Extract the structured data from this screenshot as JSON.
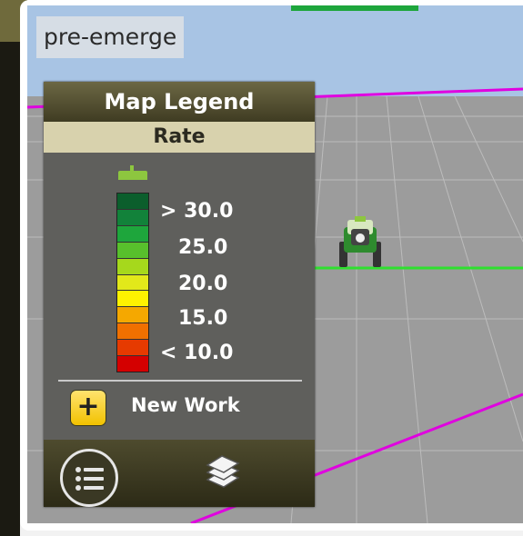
{
  "map": {
    "layer_name": "pre-emerge",
    "colors": {
      "field": "#9c9c9c",
      "sky": "#a8c4e4",
      "boundary_line": "#e000e0",
      "guidance_line": "#2ee02e"
    }
  },
  "legend": {
    "title": "Map Legend",
    "subtitle": "Rate",
    "scale_labels": [
      "> 30.0",
      "25.0",
      "20.0",
      "15.0",
      "< 10.0"
    ],
    "scale_colors": [
      "#0b5e2c",
      "#12823a",
      "#1ea63c",
      "#58c02c",
      "#a6d81c",
      "#e2e81a",
      "#fff200",
      "#f5a800",
      "#f07000",
      "#e63a00",
      "#d40000"
    ],
    "new_work_label": "New Work",
    "icons": {
      "add": "plus-icon",
      "list": "list-icon",
      "layers": "layers-icon"
    }
  },
  "vehicle": {
    "icon": "tractor-icon"
  }
}
